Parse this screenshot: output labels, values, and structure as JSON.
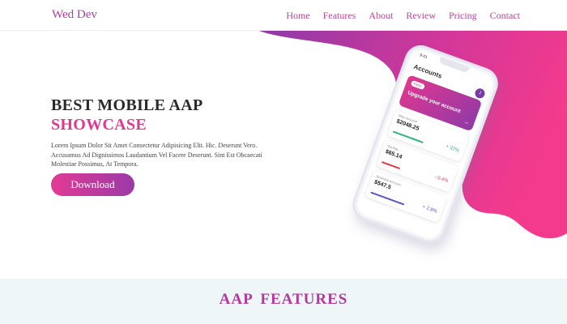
{
  "nav": {
    "brand": "Wed Dev",
    "items": [
      "Home",
      "Features",
      "About",
      "Review",
      "Pricing",
      "Contact"
    ]
  },
  "hero": {
    "title_line1": "BEST MOBILE AAP",
    "title_line2": "SHOWCASE",
    "body": "Lorem Ipsum Dolor Sit Amet Consectetur Adipisicing Elit. Hic. Deserunt Vero. Accusamus Ad Dignissimos Laudantium Vel Facere Deserunt. Sint Est Obcaecati Molestiae Possimus, At Tempora.",
    "download_label": "Download"
  },
  "phone": {
    "status_time": "9:41",
    "accounts_title": "Accounts",
    "avatar_initial": "J",
    "promo_badge": "FREE",
    "promo_text": "Upgrade your account",
    "promo_arrow": "→",
    "cards": [
      {
        "label": "Main Account",
        "value": "$2048.25",
        "change": "+ 32%",
        "color": "#2fb67c"
      },
      {
        "label": "Savings",
        "value": "$65.14",
        "change": "- 0.4%",
        "color": "#e0384a"
      },
      {
        "label": "Business Account",
        "value": "$547.5",
        "change": "+ 2.8%",
        "color": "#5a55c8"
      }
    ]
  },
  "features": {
    "title": "AAP FEATURES"
  },
  "colors": {
    "accent_pink": "#e0388f",
    "accent_purple": "#9a3aa8"
  }
}
